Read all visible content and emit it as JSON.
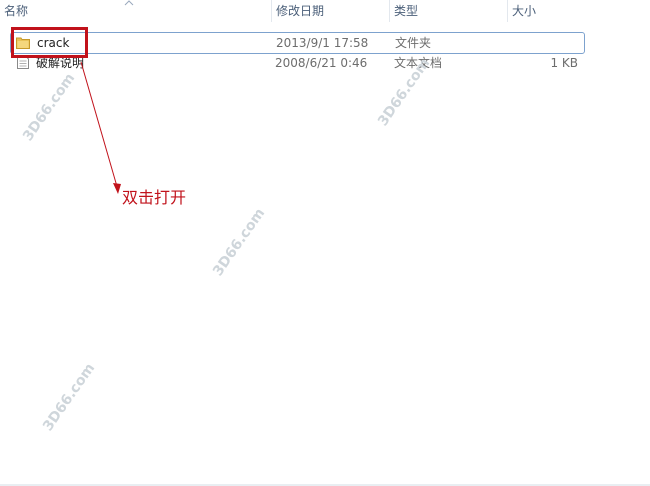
{
  "columns": {
    "name": "名称",
    "modified": "修改日期",
    "type": "类型",
    "size": "大小"
  },
  "files": [
    {
      "name": "crack",
      "modified": "2013/9/1 17:58",
      "type": "文件夹",
      "size": "",
      "icon": "folder-icon",
      "selected": true
    },
    {
      "name": "破解说明",
      "modified": "2008/6/21 0:46",
      "type": "文本文档",
      "size": "1 KB",
      "icon": "text-document-icon",
      "selected": false
    }
  ],
  "annotation": {
    "text": "双击打开",
    "color": "#c1121b"
  },
  "watermarks": [
    "3D66.com",
    "3D66.com",
    "3D66.com",
    "3D66.com"
  ],
  "colors": {
    "selection_border": "#7da2ce",
    "highlight": "#c1121b",
    "header_text": "#4c607a"
  }
}
